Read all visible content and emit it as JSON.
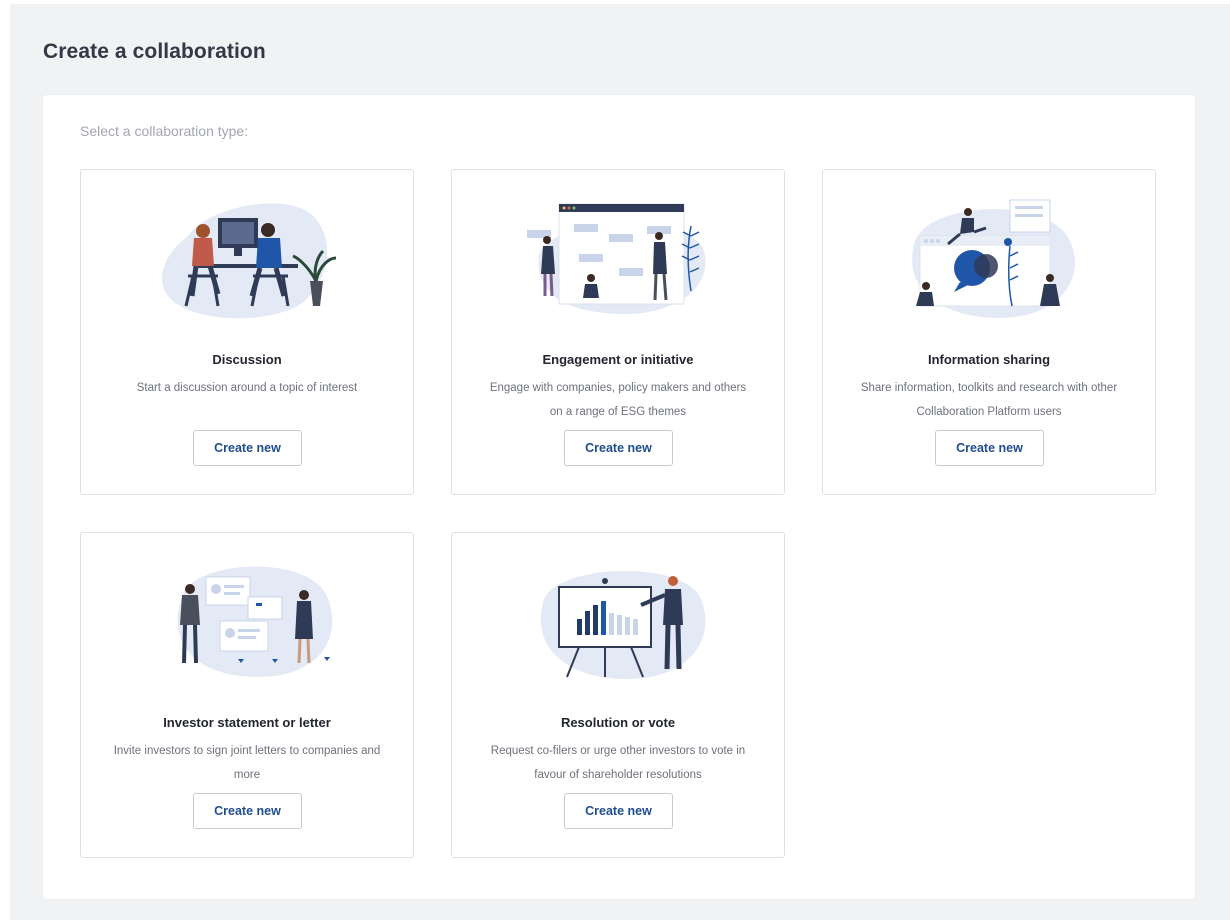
{
  "page": {
    "title": "Create a collaboration",
    "subtitle": "Select a collaboration type:"
  },
  "colors": {
    "brand_navy": "#1f3a6b",
    "blob": "#e3e9f5",
    "button_text": "#1f4d8f"
  },
  "cards": [
    {
      "title": "Discussion",
      "description": "Start a discussion around a topic of interest",
      "button_label": "Create new",
      "icon": "discussion-illustration-icon"
    },
    {
      "title": "Engagement or initiative",
      "description": "Engage with companies, policy makers and others on a range of ESG themes",
      "button_label": "Create new",
      "icon": "engagement-illustration-icon"
    },
    {
      "title": "Information sharing",
      "description": "Share information, toolkits and research with other Collaboration Platform users",
      "button_label": "Create new",
      "icon": "information-sharing-illustration-icon"
    },
    {
      "title": "Investor statement or letter",
      "description": "Invite investors to sign joint letters to companies and more",
      "button_label": "Create new",
      "icon": "investor-letter-illustration-icon"
    },
    {
      "title": "Resolution or vote",
      "description": "Request co-filers or urge other investors to vote in favour of shareholder resolutions",
      "button_label": "Create new",
      "icon": "resolution-vote-illustration-icon"
    }
  ]
}
